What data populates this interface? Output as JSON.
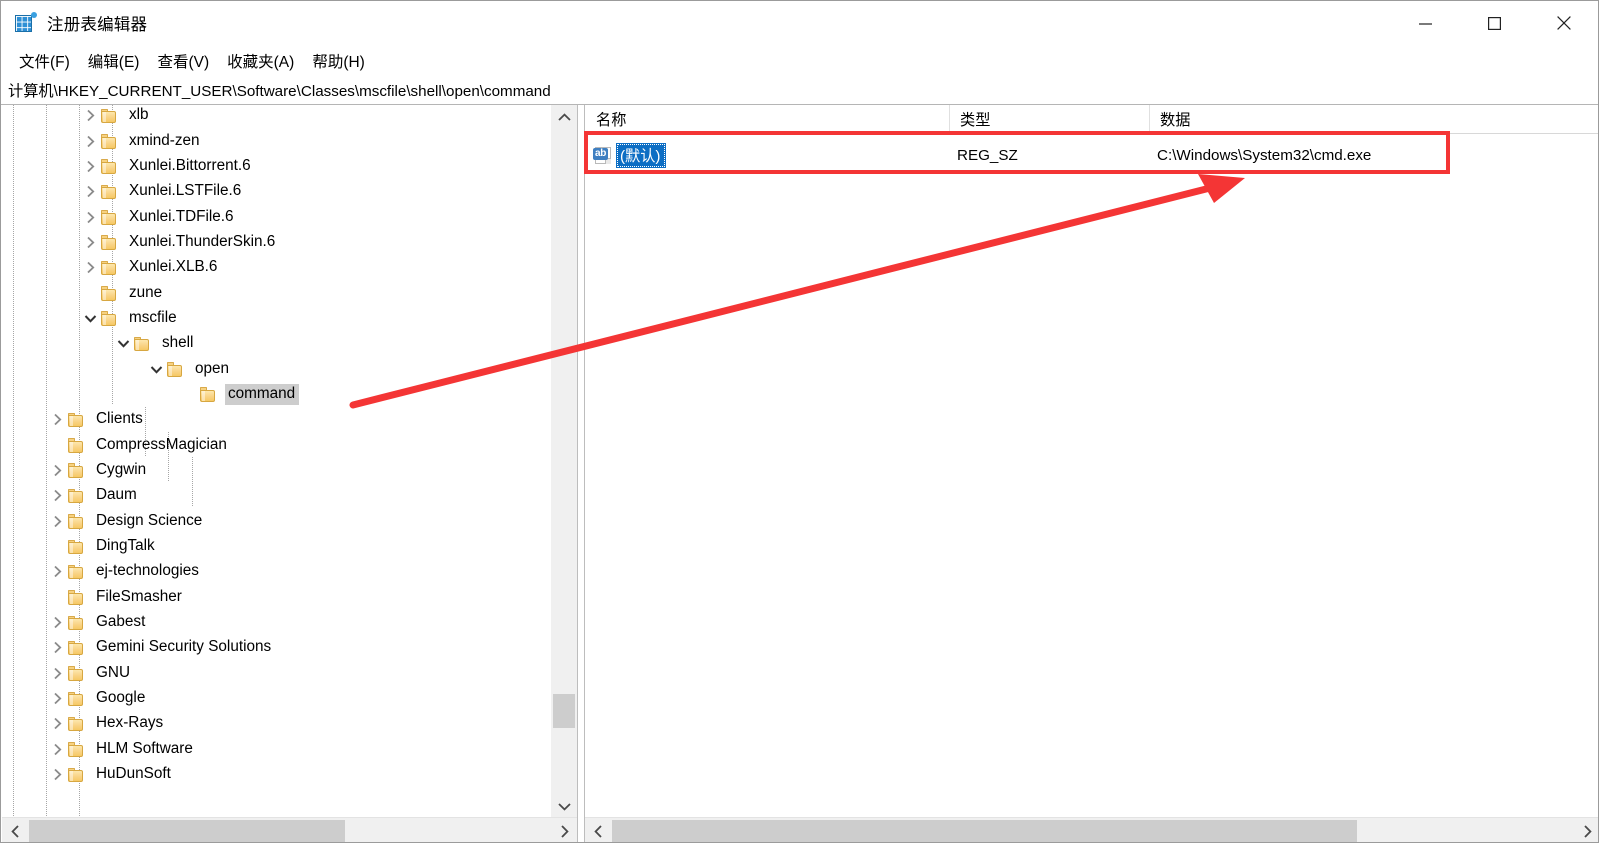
{
  "window": {
    "title": "注册表编辑器",
    "icon": "registry-editor-icon",
    "controls": {
      "minimize": "最小化",
      "maximize": "最大化",
      "close": "关闭"
    }
  },
  "menubar": {
    "items": [
      {
        "label": "文件(F)",
        "name": "menu-file"
      },
      {
        "label": "编辑(E)",
        "name": "menu-edit"
      },
      {
        "label": "查看(V)",
        "name": "menu-view"
      },
      {
        "label": "收藏夹(A)",
        "name": "menu-favorites"
      },
      {
        "label": "帮助(H)",
        "name": "menu-help"
      }
    ]
  },
  "address": {
    "path": "计算机\\HKEY_CURRENT_USER\\Software\\Classes\\mscfile\\shell\\open\\command"
  },
  "tree": {
    "rows": [
      {
        "label": "xlb",
        "indent": 3,
        "twisty": "collapsed",
        "selected": false
      },
      {
        "label": "xmind-zen",
        "indent": 3,
        "twisty": "collapsed",
        "selected": false
      },
      {
        "label": "Xunlei.Bittorrent.6",
        "indent": 3,
        "twisty": "collapsed",
        "selected": false
      },
      {
        "label": "Xunlei.LSTFile.6",
        "indent": 3,
        "twisty": "collapsed",
        "selected": false
      },
      {
        "label": "Xunlei.TDFile.6",
        "indent": 3,
        "twisty": "collapsed",
        "selected": false
      },
      {
        "label": "Xunlei.ThunderSkin.6",
        "indent": 3,
        "twisty": "collapsed",
        "selected": false
      },
      {
        "label": "Xunlei.XLB.6",
        "indent": 3,
        "twisty": "collapsed",
        "selected": false
      },
      {
        "label": "zune",
        "indent": 3,
        "twisty": "none",
        "selected": false
      },
      {
        "label": "mscfile",
        "indent": 3,
        "twisty": "expanded",
        "selected": false
      },
      {
        "label": "shell",
        "indent": 4,
        "twisty": "expanded",
        "selected": false
      },
      {
        "label": "open",
        "indent": 5,
        "twisty": "expanded",
        "selected": false
      },
      {
        "label": "command",
        "indent": 6,
        "twisty": "none",
        "selected": true
      },
      {
        "label": "Clients",
        "indent": 2,
        "twisty": "collapsed",
        "selected": false
      },
      {
        "label": "CompressMagician",
        "indent": 2,
        "twisty": "none",
        "selected": false
      },
      {
        "label": "Cygwin",
        "indent": 2,
        "twisty": "collapsed",
        "selected": false
      },
      {
        "label": "Daum",
        "indent": 2,
        "twisty": "collapsed",
        "selected": false
      },
      {
        "label": "Design Science",
        "indent": 2,
        "twisty": "collapsed",
        "selected": false
      },
      {
        "label": "DingTalk",
        "indent": 2,
        "twisty": "none",
        "selected": false
      },
      {
        "label": "ej-technologies",
        "indent": 2,
        "twisty": "collapsed",
        "selected": false
      },
      {
        "label": "FileSmasher",
        "indent": 2,
        "twisty": "none",
        "selected": false
      },
      {
        "label": "Gabest",
        "indent": 2,
        "twisty": "collapsed",
        "selected": false
      },
      {
        "label": "Gemini Security Solutions",
        "indent": 2,
        "twisty": "collapsed",
        "selected": false
      },
      {
        "label": "GNU",
        "indent": 2,
        "twisty": "collapsed",
        "selected": false
      },
      {
        "label": "Google",
        "indent": 2,
        "twisty": "collapsed",
        "selected": false
      },
      {
        "label": "Hex-Rays",
        "indent": 2,
        "twisty": "collapsed",
        "selected": false
      },
      {
        "label": "HLM Software",
        "indent": 2,
        "twisty": "collapsed",
        "selected": false
      },
      {
        "label": "HuDunSoft",
        "indent": 2,
        "twisty": "collapsed",
        "selected": false
      }
    ]
  },
  "list": {
    "columns": [
      {
        "label": "名称",
        "name": "column-name"
      },
      {
        "label": "类型",
        "name": "column-type"
      },
      {
        "label": "数据",
        "name": "column-data"
      }
    ],
    "rows": [
      {
        "name": "(默认)",
        "type": "REG_SZ",
        "data": "C:\\Windows\\System32\\cmd.exe",
        "icon": "string-value-icon",
        "selected": true
      }
    ]
  },
  "annotation": {
    "highlight_color": "#f43535",
    "arrow_color": "#f43535"
  },
  "scrollbars": {
    "tree_v_up": "▲",
    "tree_v_down": "▼",
    "tree_h_left": "◀",
    "tree_h_right": "▶",
    "list_h_left": "◀",
    "list_h_right": "▶"
  }
}
